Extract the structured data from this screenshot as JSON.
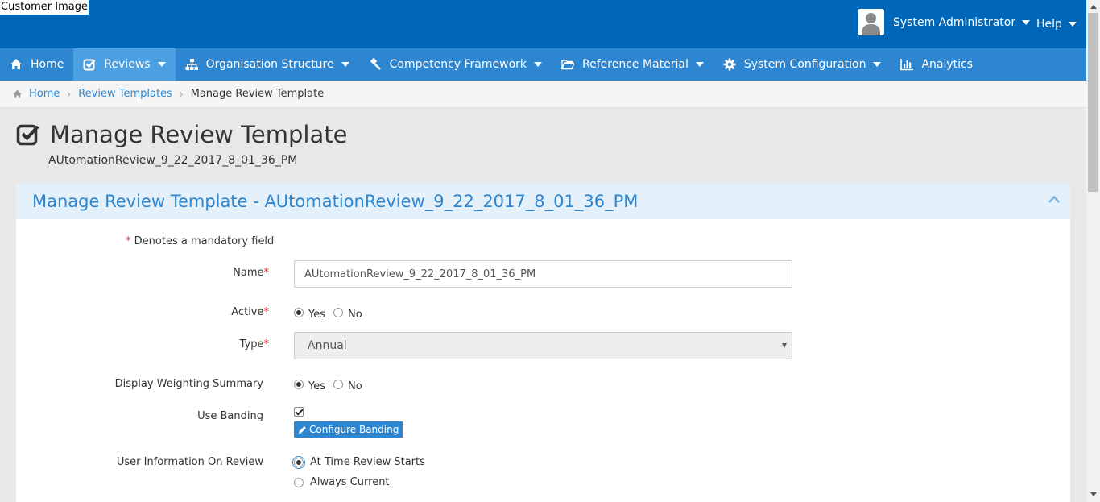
{
  "header": {
    "logo_alt": "Customer Image",
    "user_name": "System Administrator",
    "help_label": "Help"
  },
  "nav": {
    "items": [
      {
        "label": "Home",
        "icon": "home-icon"
      },
      {
        "label": "Reviews",
        "icon": "check-square-icon"
      },
      {
        "label": "Organisation Structure",
        "icon": "sitemap-icon"
      },
      {
        "label": "Competency Framework",
        "icon": "gavel-icon"
      },
      {
        "label": "Reference Material",
        "icon": "folder-open-icon"
      },
      {
        "label": "System Configuration",
        "icon": "gear-icon"
      },
      {
        "label": "Analytics",
        "icon": "bar-chart-icon"
      }
    ],
    "active_index": 1
  },
  "breadcrumb": {
    "home": "Home",
    "parent": "Review Templates",
    "current": "Manage Review Template"
  },
  "page": {
    "title": "Manage Review Template",
    "subtitle": "AUtomationReview_9_22_2017_8_01_36_PM"
  },
  "panel": {
    "title": "Manage Review Template - AUtomationReview_9_22_2017_8_01_36_PM"
  },
  "form": {
    "mandatory_asterisk": "*",
    "mandatory_note": "Denotes a mandatory field",
    "name_label": "Name",
    "name_value": "AUtomationReview_9_22_2017_8_01_36_PM",
    "active_label": "Active",
    "active_yes": "Yes",
    "active_no": "No",
    "active_selected": "Yes",
    "type_label": "Type",
    "type_value": "Annual",
    "weighting_label": "Display Weighting Summary",
    "weighting_yes": "Yes",
    "weighting_no": "No",
    "weighting_selected": "Yes",
    "banding_label": "Use Banding",
    "banding_checked": true,
    "configure_banding": "Configure Banding",
    "user_info_label": "User Information On Review",
    "user_info_opt1": "At Time Review Starts",
    "user_info_opt2": "Always Current",
    "user_info_selected": "At Time Review Starts"
  },
  "colors": {
    "topbar": "#0067b8",
    "navbar": "#2e86d1",
    "nav_active": "#4c9fe0",
    "panel_heading": "#e4f1fb",
    "required": "#c9302c"
  }
}
